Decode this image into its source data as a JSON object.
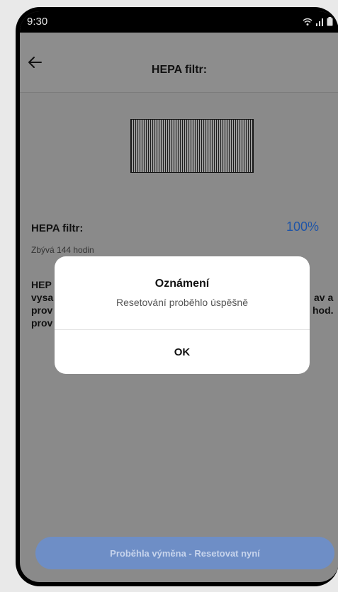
{
  "status_bar": {
    "time": "9:30",
    "icons": [
      "wifi-icon",
      "signal-icon",
      "battery-icon"
    ]
  },
  "app_bar": {
    "back_icon": "arrow-left-icon",
    "title": "HEPA filtr:"
  },
  "filter": {
    "image_icon": "hepa-filter-image",
    "label": "HEPA filtr:",
    "percent": "100%",
    "level": 1.0,
    "remaining": "Zbývá 144 hodin"
  },
  "description": {
    "line1_left": "HEP",
    "line2_left": "vysa",
    "line2_right": "av a",
    "line3_left": "prov",
    "line3_right": "hod.",
    "line4_left": "prov"
  },
  "dialog": {
    "title": "Oznámení",
    "message": "Resetování proběhlo úspěšně",
    "ok_label": "OK"
  },
  "footer": {
    "reset_button_label": "Proběhla výměna - Resetovat nyní"
  },
  "colors": {
    "accent": "#1f55a8",
    "button": "#6e8ec6",
    "overlay": "#8a8a8a"
  }
}
